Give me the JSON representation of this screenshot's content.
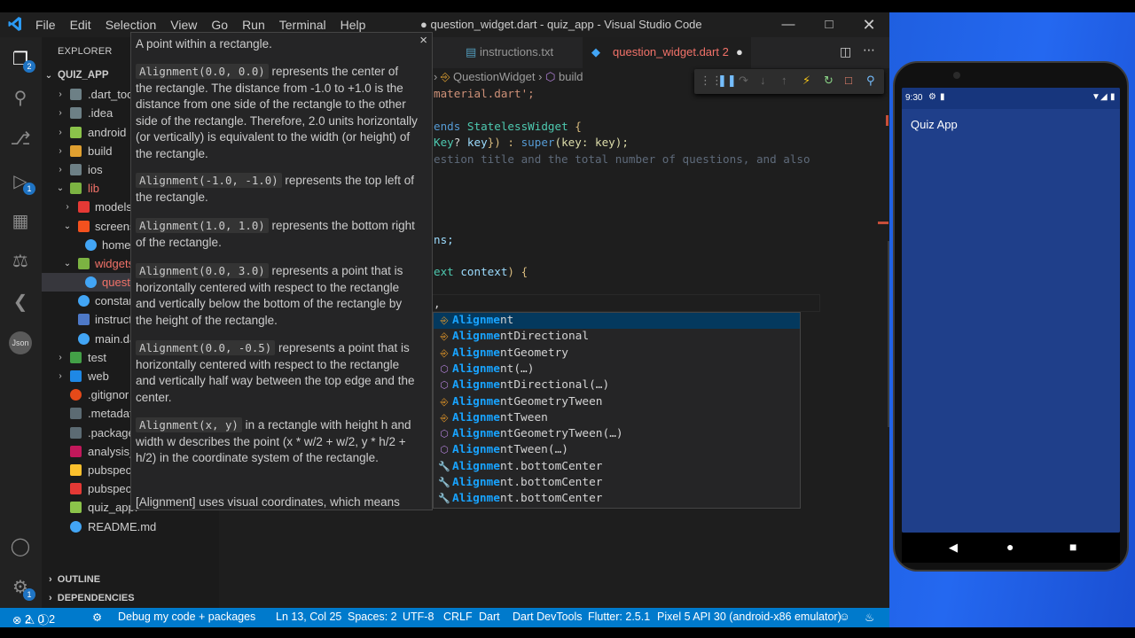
{
  "window": {
    "title": "● question_widget.dart - quiz_app - Visual Studio Code"
  },
  "menu": [
    "File",
    "Edit",
    "Selection",
    "View",
    "Go",
    "Run",
    "Terminal",
    "Help"
  ],
  "activity": {
    "explorer_badge": "2",
    "debug_badge": "1",
    "settings_badge": "1"
  },
  "sidebar": {
    "title": "EXPLORER",
    "root": "QUIZ_APP",
    "items": [
      ".dart_tool",
      ".idea",
      "android",
      "build",
      "ios",
      "lib",
      "models",
      "screens",
      "home",
      "widgets",
      "quest",
      "constar",
      "instruct",
      "main.da",
      "test",
      "web",
      ".gitignor",
      ".metadat",
      ".package",
      "analysis_",
      "pubspec",
      "pubspec",
      "quiz_app.",
      "README.md"
    ],
    "outline": "OUTLINE",
    "dependencies": "DEPENDENCIES"
  },
  "tabs": [
    {
      "label": "instructions.txt"
    },
    {
      "label": "question_widget.dart",
      "badge": "2"
    }
  ],
  "breadcrumb": {
    "class": "QuestionWidget",
    "method": "build"
  },
  "code": {
    "l1": "material.dart';",
    "l2a": "ends ",
    "l2b": "StatelessWidget",
    "l2c": " {",
    "l3a": "Key",
    "l3b": "? ",
    "l3c": "key",
    "l3d": "}) : ",
    "l3e": "super",
    "l3f": "(key: key);",
    "l4": "estion title and the total number of questions, and also",
    "l5": "ns;",
    "l6a": "ext ",
    "l6b": "context",
    "l6c": ") {",
    "l7": ","
  },
  "hover": {
    "close": "×",
    "p1": "A point within a rectangle.",
    "p2_code": "Alignment(0.0, 0.0)",
    "p2_text": " represents the center of the rectangle. The distance from -1.0 to +1.0 is the distance from one side of the rectangle to the other side of the rectangle. Therefore, 2.0 units horizontally (or vertically) is equivalent to the width (or height) of the rectangle.",
    "p3_code": "Alignment(-1.0, -1.0)",
    "p3_text": " represents the top left of the rectangle.",
    "p4_code": "Alignment(1.0, 1.0)",
    "p4_text": " represents the bottom right of the rectangle.",
    "p5_code": "Alignment(0.0, 3.0)",
    "p5_text": " represents a point that is horizontally centered with respect to the rectangle and vertically below the bottom of the rectangle by the height of the rectangle.",
    "p6_code": "Alignment(0.0, -0.5)",
    "p6_text": " represents a point that is horizontally centered with respect to the rectangle and vertically half way between the top edge and the center.",
    "p7_code": "Alignment(x, y)",
    "p7_text": " in a rectangle with height h and width w describes the point (x * w/2 + w/2, y * h/2 + h/2) in the coordinate system of the rectangle.",
    "p8": "[Alignment] uses visual coordinates, which means"
  },
  "suggestions": [
    {
      "match": "Alignme",
      "rest": "nt",
      "kind": "class"
    },
    {
      "match": "Alignme",
      "rest": "ntDirectional",
      "kind": "class"
    },
    {
      "match": "Alignme",
      "rest": "ntGeometry",
      "kind": "class"
    },
    {
      "match": "Alignme",
      "rest": "nt(…)",
      "kind": "ctor"
    },
    {
      "match": "Alignme",
      "rest": "ntDirectional(…)",
      "kind": "ctor"
    },
    {
      "match": "Alignme",
      "rest": "ntGeometryTween",
      "kind": "class"
    },
    {
      "match": "Alignme",
      "rest": "ntTween",
      "kind": "class"
    },
    {
      "match": "Alignme",
      "rest": "ntGeometryTween(…)",
      "kind": "ctor"
    },
    {
      "match": "Alignme",
      "rest": "ntTween(…)",
      "kind": "ctor"
    },
    {
      "match": "Alignme",
      "rest": "nt.bottomCenter",
      "kind": "const"
    },
    {
      "match": "Alignme",
      "rest": "nt.bottomCenter",
      "kind": "const"
    },
    {
      "match": "Alignme",
      "rest": "nt.bottomCenter",
      "kind": "const"
    }
  ],
  "status": {
    "errors": "2",
    "warnings": "0",
    "infos": "2",
    "debug": "Debug my code + packages",
    "position": "Ln 13, Col 25",
    "spaces": "Spaces: 2",
    "encoding": "UTF-8",
    "eol": "CRLF",
    "language": "Dart",
    "devtools": "Dart DevTools",
    "flutter": "Flutter: 2.5.1",
    "device": "Pixel 5 API 30 (android-x86 emulator)"
  },
  "phone": {
    "time": "9:30",
    "app_title": "Quiz App"
  },
  "colors": {
    "accent": "#007acc",
    "match": "#18a3ff",
    "emulator_bg": "#2468f0",
    "app_bg": "#1f3f8a"
  }
}
